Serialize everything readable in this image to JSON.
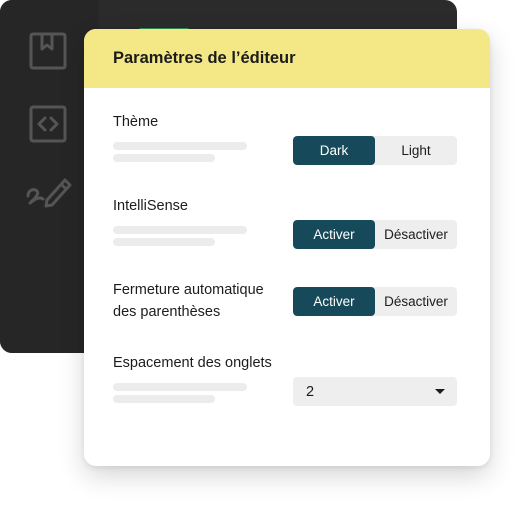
{
  "sidebar": {
    "icons": [
      "bookmark-icon",
      "code-icon",
      "pen-icon"
    ]
  },
  "panel": {
    "title": "Paramètres de l’éditeur"
  },
  "settings": {
    "theme": {
      "label": "Thème",
      "options": [
        "Dark",
        "Light"
      ],
      "selected": "Dark"
    },
    "intellisense": {
      "label": "IntelliSense",
      "options": [
        "Activer",
        "Désactiver"
      ],
      "selected": "Activer"
    },
    "autoclose": {
      "label_line1": "Fermeture automatique",
      "label_line2": "des parenthèses",
      "options": [
        "Activer",
        "Désactiver"
      ],
      "selected": "Activer"
    },
    "tabsize": {
      "label": "Espacement des onglets",
      "value": "2"
    }
  },
  "colors": {
    "header_bg": "#f4e886",
    "active_segment": "#164a5a",
    "dark_window": "#2b2b2b",
    "green_accent": "#2f8d50"
  }
}
